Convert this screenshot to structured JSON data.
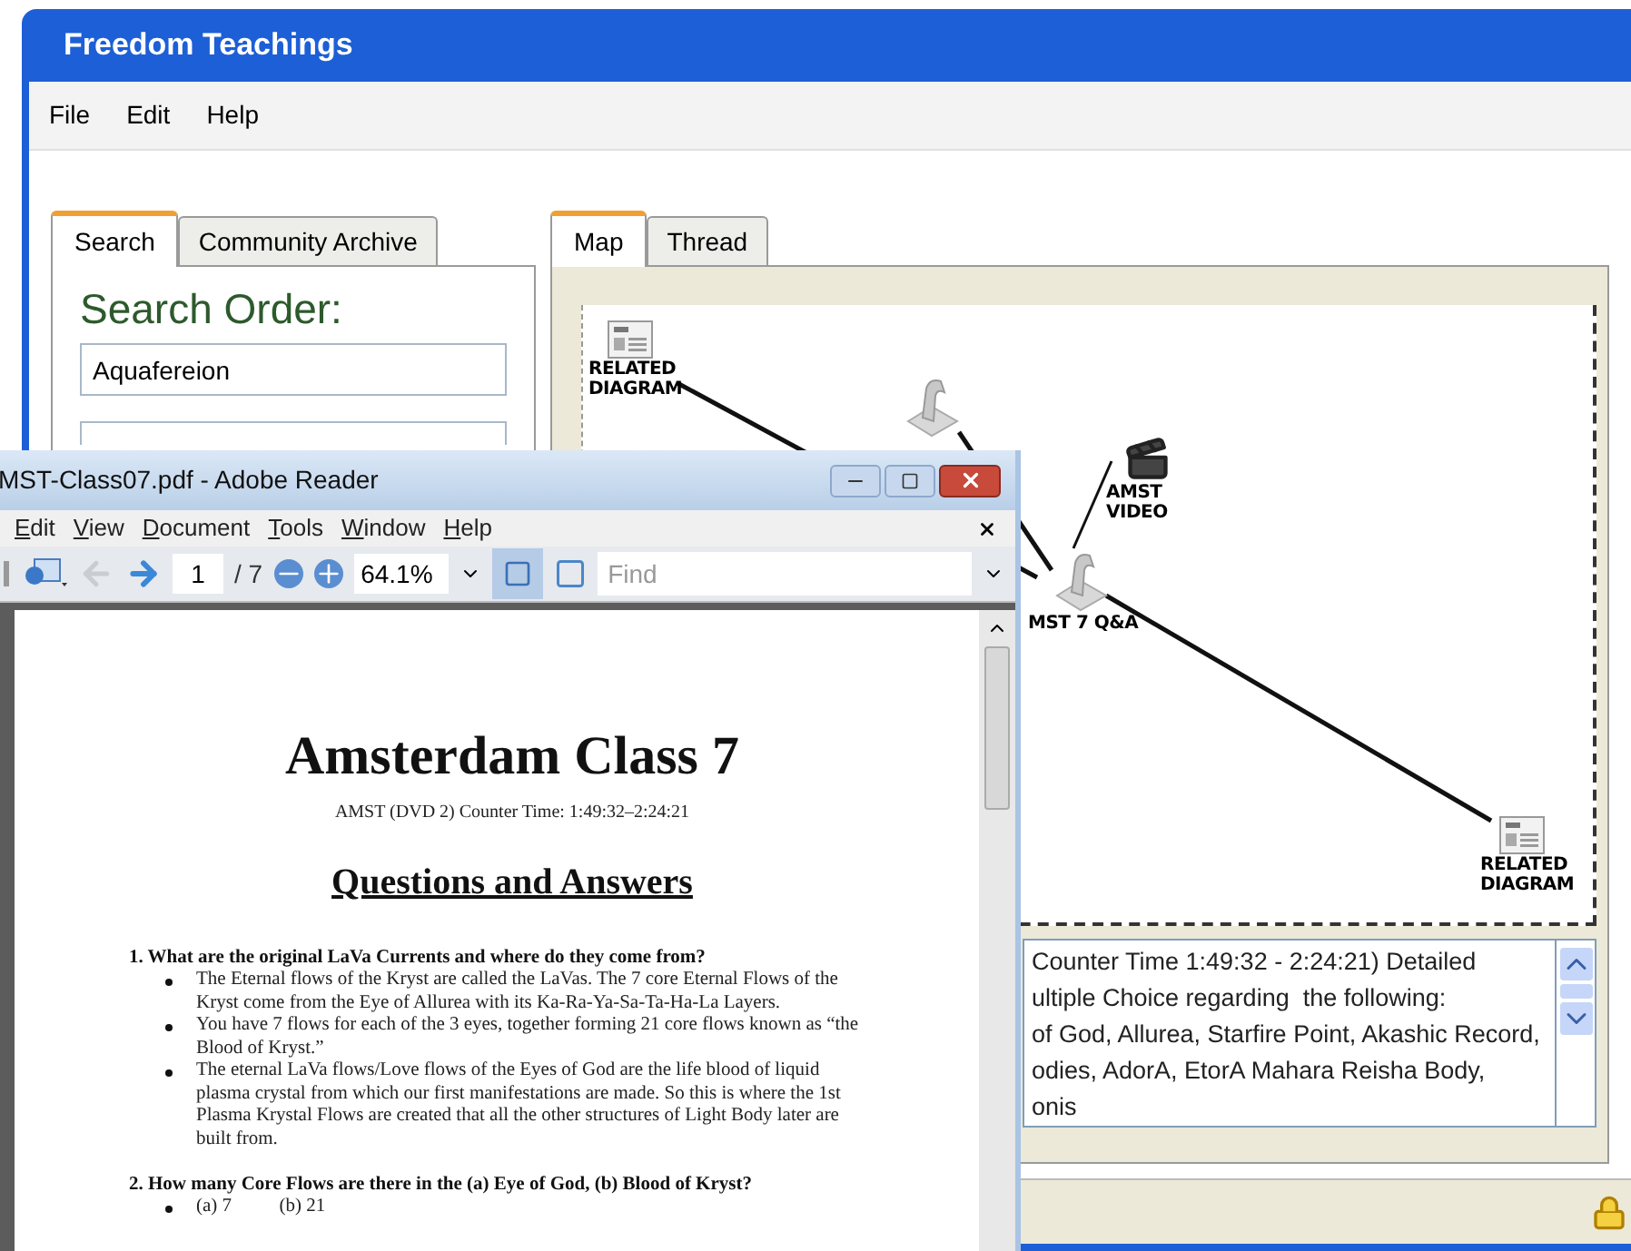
{
  "window": {
    "title": "Freedom Teachings"
  },
  "menu": [
    "File",
    "Edit",
    "Help"
  ],
  "left_tabs": [
    {
      "label": "Search",
      "selected": true
    },
    {
      "label": "Community Archive",
      "selected": false
    }
  ],
  "search": {
    "heading": "Search Order:",
    "fields": [
      "Aquafereion"
    ]
  },
  "right_tabs": [
    {
      "label": "Map",
      "selected": true
    },
    {
      "label": "Thread",
      "selected": false
    }
  ],
  "map": {
    "nodes": [
      {
        "kind": "diagram",
        "label": "RELATED DIAGRAM"
      },
      {
        "kind": "figure"
      },
      {
        "kind": "video",
        "label": "AMST VIDEO"
      },
      {
        "kind": "figure",
        "label": "MST 7 Q&A"
      },
      {
        "kind": "diagram",
        "label": "RELATED DIAGRAM"
      }
    ]
  },
  "description": [
    "Counter Time 1:49:32 - 2:24:21) Detailed",
    "ultiple Choice regarding  the following:",
    "of God, Allurea, Starfire Point, Akashic Record,",
    "odies, AdorA, EtorA Mahara Reisha Body,",
    "onis"
  ],
  "reader": {
    "title": "MST-Class07.pdf - Adobe Reader",
    "menu": [
      "Edit",
      "View",
      "Document",
      "Tools",
      "Window",
      "Help"
    ],
    "page": "1",
    "pages": "/ 7",
    "zoom": "64.1%",
    "find_placeholder": "Find",
    "document": {
      "title": "Amsterdam Class 7",
      "subtitle": "AMST (DVD 2) Counter Time: 1:49:32–2:24:21",
      "heading": "Questions and Answers",
      "questions": [
        {
          "question": "1. What are the original LaVa Currents and where do they come from?",
          "answers": [
            "The Eternal flows of the Kryst are called the LaVas. The 7 core Eternal Flows of the Kryst come from the Eye of Allurea with its Ka-Ra-Ya-Sa-Ta-Ha-La Layers.",
            "You have 7 flows for each of the 3 eyes, together forming 21 core flows known as “the Blood of Kryst.”",
            "The eternal LaVa flows/Love flows of the Eyes of God are the life blood of liquid plasma crystal from which our first manifestations are made. So this is where the 1st Plasma Krystal Flows are created that all the other structures of Light Body later are built from."
          ]
        },
        {
          "question": "2. How many Core Flows are there in the (a) Eye of God, (b) Blood of Kryst?",
          "answers": [
            "(a) 7          (b) 21"
          ]
        }
      ]
    }
  }
}
